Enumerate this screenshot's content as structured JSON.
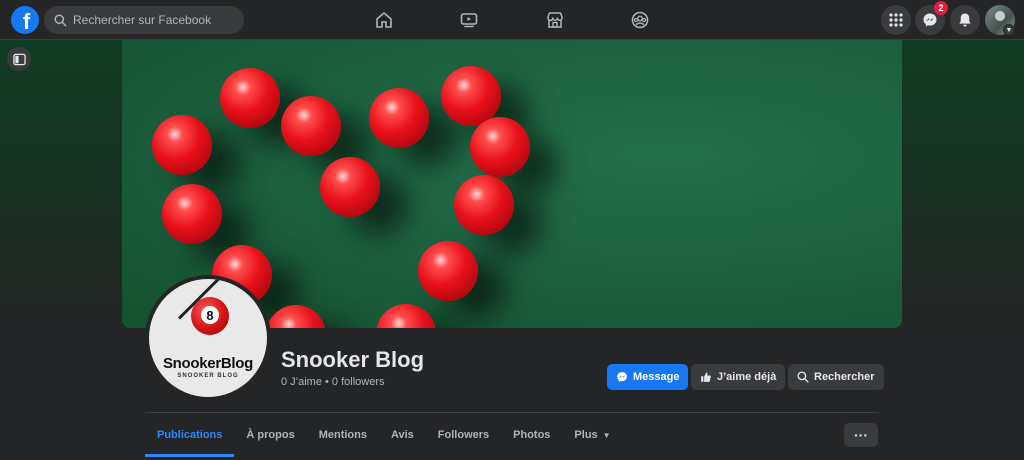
{
  "header": {
    "logo_letter": "f",
    "search_placeholder": "Rechercher sur Facebook",
    "nav_icons": [
      "home-icon",
      "watch-icon",
      "marketplace-icon",
      "groups-icon"
    ],
    "right_icons": [
      "menu-grid-icon",
      "messenger-icon",
      "notifications-icon"
    ],
    "messenger_badge": "2"
  },
  "cover": {
    "description_colors": {
      "felt": "#1d6240",
      "ball": "#e8101a"
    }
  },
  "profile": {
    "logo_number": "8",
    "logo_title": "SnookerBlog",
    "logo_subtitle": "SNOOKER BLOG",
    "name": "Snooker Blog",
    "stats": "0 J’aime • 0 followers"
  },
  "actions": {
    "message": "Message",
    "liked": "J’aime déjà",
    "search": "Rechercher"
  },
  "tabs": [
    {
      "label": "Publications",
      "active": true
    },
    {
      "label": "À propos"
    },
    {
      "label": "Mentions"
    },
    {
      "label": "Avis"
    },
    {
      "label": "Followers"
    },
    {
      "label": "Photos"
    },
    {
      "label": "Plus"
    }
  ],
  "more_button": "···",
  "colors": {
    "accent": "#1877f2",
    "tab_active": "#2d88ff",
    "background": "#242526",
    "badge": "#e41e3f"
  }
}
